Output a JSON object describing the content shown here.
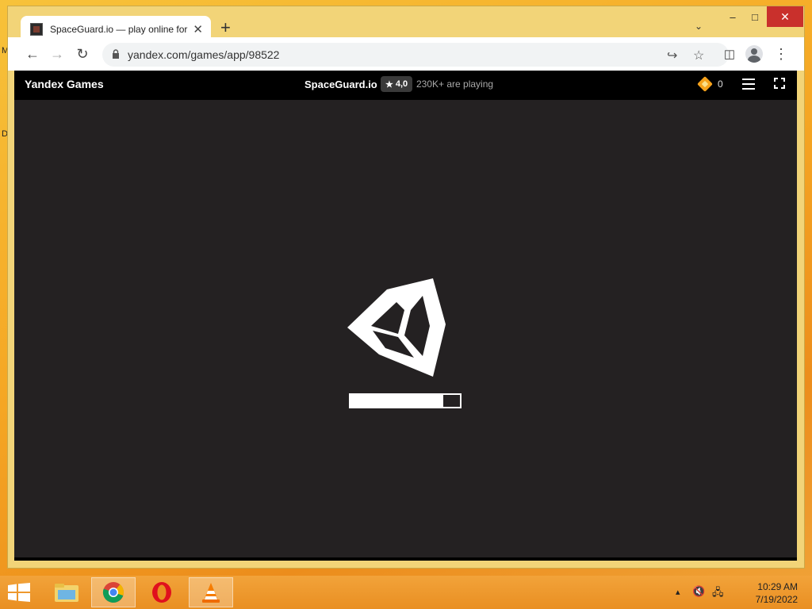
{
  "desktop": {
    "edge_left": "M",
    "edge_left_2": "D"
  },
  "browser": {
    "tab": {
      "title": "SpaceGuard.io — play online for free",
      "favicon": "game-favicon"
    },
    "new_tab": "+",
    "url": "yandex.com/games/app/98522",
    "window_controls": {
      "minimize": "–",
      "maximize": "□",
      "close": "✕"
    }
  },
  "site": {
    "brand": "Yandex Games",
    "game_title": "SpaceGuard.io",
    "rating": "4,0",
    "rating_star": "★",
    "players": "230K+ are playing",
    "coins": "0"
  },
  "game": {
    "loader": "unity-logo",
    "progress": 0.85
  },
  "taskbar": {
    "apps": [
      "file-explorer",
      "chrome",
      "opera",
      "vlc"
    ],
    "time": "10:29 AM",
    "date": "7/19/2022"
  },
  "colors": {
    "desktop": "#f5a623",
    "page_bg": "#242122",
    "header_bg": "#000000",
    "close_button": "#c9302c",
    "coin": "#f6a21b"
  }
}
